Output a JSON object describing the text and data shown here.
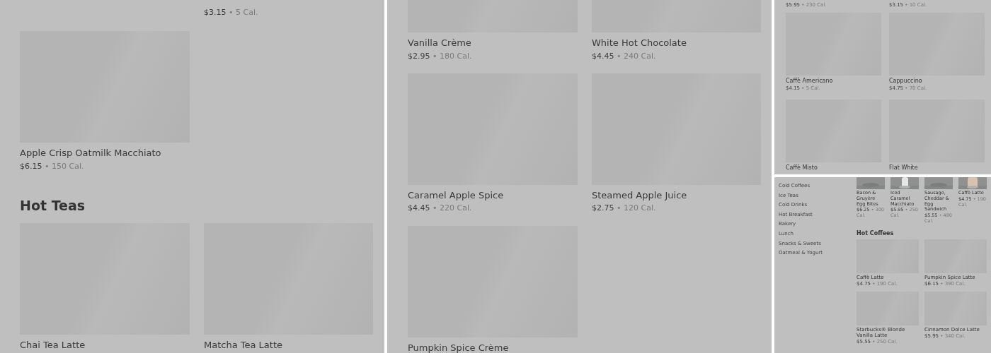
{
  "panels": [
    {
      "kind": "large",
      "blocks": [
        {
          "kind": "captions-right",
          "items": [
            {
              "price": "$3.15",
              "calories": "• 5 Cal."
            }
          ]
        },
        {
          "kind": "grid",
          "items": [
            {
              "name": "Apple Crisp Oatmilk Macchiato",
              "price": "$6.15",
              "calories": "• 150 Cal."
            }
          ]
        },
        {
          "kind": "heading",
          "text": "Hot Teas"
        },
        {
          "kind": "grid",
          "items": [
            {
              "name": "Chai Tea Latte"
            },
            {
              "name": "Matcha Tea Latte"
            }
          ]
        }
      ]
    },
    {
      "kind": "large-scrolled",
      "blocks": [
        {
          "kind": "grid",
          "items": [
            {
              "name": "Vanilla Crème",
              "price": "$2.95",
              "calories": "• 180 Cal."
            },
            {
              "name": "White Hot Chocolate",
              "price": "$4.45",
              "calories": "• 240 Cal."
            },
            {
              "name": "Caramel Apple Spice",
              "price": "$4.45",
              "calories": "• 220 Cal."
            },
            {
              "name": "Steamed Apple Juice",
              "price": "$2.75",
              "calories": "• 120 Cal."
            },
            {
              "name": "Pumpkin Spice Crème"
            }
          ]
        }
      ]
    },
    {
      "kind": "small",
      "blocks": [
        {
          "kind": "captions",
          "items": [
            {
              "price": "$5.95",
              "calories": "• 230 Cal."
            },
            {
              "price": "$3.15",
              "calories": "• 10 Cal."
            }
          ]
        },
        {
          "kind": "grid",
          "items": [
            {
              "name": "Caffè Americano",
              "price": "$4.15",
              "calories": "• 5 Cal."
            },
            {
              "name": "Cappuccino",
              "price": "$4.75",
              "calories": "• 70 Cal."
            },
            {
              "name": "Caffè Misto"
            },
            {
              "name": "Flat White"
            }
          ]
        }
      ]
    },
    {
      "kind": "tiny",
      "sidebar": [
        "Cold Coffees",
        "Ice Teas",
        "Cold Drinks",
        "Hot Breakfast",
        "Bakery",
        "Lunch",
        "Snacks & Sweets",
        "Oatmeal & Yogurt"
      ],
      "blocks": [
        {
          "kind": "thumbs",
          "items": [
            {
              "name": "Bacon & Gruyère Egg Bites",
              "price": "$6.25",
              "calories": "• 300 Cal."
            },
            {
              "name": "Iced Caramel Macchiato",
              "price": "$5.95",
              "calories": "• 250 Cal."
            },
            {
              "name": "Sausage, Cheddar & Egg Sandwich",
              "price": "$5.55",
              "calories": "• 480 Cal."
            },
            {
              "name": "Caffè Latte",
              "price": "$4.75",
              "calories": "• 190 Cal."
            }
          ]
        },
        {
          "kind": "heading",
          "text": "Hot Coffees"
        },
        {
          "kind": "grid",
          "items": [
            {
              "name": "Caffè Latte",
              "price": "$4.75",
              "calories": "• 190 Cal."
            },
            {
              "name": "Pumpkin Spice Latte",
              "price": "$6.15",
              "calories": "• 390 Cal."
            },
            {
              "name": "Starbucks® Blonde Vanilla Latte",
              "price": "$5.55",
              "calories": "• 250 Cal."
            },
            {
              "name": "Cinnamon Dolce Latte",
              "price": "$5.95",
              "calories": "• 340 Cal."
            }
          ]
        }
      ]
    }
  ]
}
